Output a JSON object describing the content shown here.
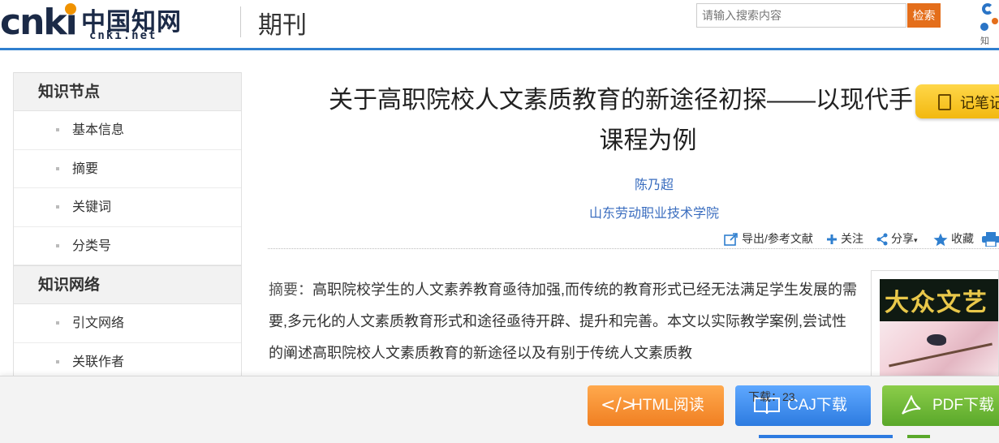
{
  "header": {
    "logo_text": "cnki",
    "logo_cn": "中国知网",
    "logo_domain": "cnki.net",
    "section": "期刊",
    "search_placeholder": "请输入搜索内容",
    "search_button": "检索",
    "corner_logo_text": "知"
  },
  "sidebar": {
    "groups": [
      {
        "title": "知识节点",
        "items": [
          "基本信息",
          "摘要",
          "关键词",
          "分类号"
        ]
      },
      {
        "title": "知识网络",
        "items": [
          "引文网络",
          "关联作者"
        ]
      }
    ]
  },
  "article": {
    "title_line1": "关于高职院校人文素质教育的新途径初探——以现代手",
    "title_line2": "课程为例",
    "author": "陈乃超",
    "organization": "山东劳动职业技术学院",
    "note_button": "记笔记",
    "tools": {
      "export": "导出/参考文献",
      "follow": "关注",
      "share": "分享",
      "favorite": "收藏"
    },
    "abstract_label": "摘要：",
    "abstract_text": "高职院校学生的人文素养教育亟待加强,而传统的教育形式已经无法满足学生发展的需要,多元化的人文素质教育形式和途径亟待开辟、提升和完善。本文以实际教学案例,尝试性的阐述高职院校人文素质教育的新途径以及有别于传统人文素质教"
  },
  "cover": {
    "journal_title": "大众文艺"
  },
  "bottom": {
    "html_read": "HTML阅读",
    "caj_download": "CAJ下载",
    "pdf_download": "PDF下载",
    "download_count": "下载：23"
  },
  "colors": {
    "brand_blue": "#2f7fcf",
    "search_orange": "#e46e1b",
    "link_blue": "#3a6dbf",
    "html_btn": "#f07f22",
    "caj_btn": "#2d7be0",
    "pdf_btn": "#5aa82a",
    "note_btn": "#f2b80f"
  }
}
